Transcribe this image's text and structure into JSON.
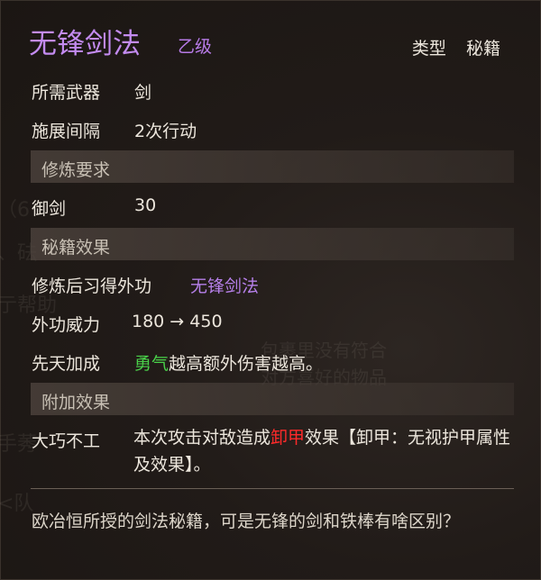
{
  "skill": {
    "name": "无锋剑法",
    "grade": "乙级",
    "type_label": "类型",
    "type_value": "秘籍"
  },
  "stats": {
    "weapon_label": "所需武器",
    "weapon_value": "剑",
    "interval_label": "施展间隔",
    "interval_value": "2次行动"
  },
  "requirements": {
    "header": "修炼要求",
    "skill_label": "御剑",
    "skill_value": "30"
  },
  "effects": {
    "header": "秘籍效果",
    "learn_label": "修炼后习得外功",
    "learn_value": "无锋剑法",
    "power_label": "外功威力",
    "power_value": "180 → 450",
    "innate_label": "先天加成",
    "innate_attr": "勇气",
    "innate_text": "越高额外伤害越高。"
  },
  "bonus": {
    "header": "附加效果",
    "name": "大巧不工",
    "desc_pre": "本次攻击对敌造成",
    "desc_red": "卸甲",
    "desc_post": "效果【卸甲：无视护甲属性及效果】。"
  },
  "flavor": "欧冶恒所授的剑法秘籍，可是无锋的剑和铁棒有啥区别？",
  "colors": {
    "title": "#c38bf0",
    "accent_purple": "#b57fe8",
    "attr_green": "#4ad24a",
    "debuff_red": "#ff2a2a"
  }
}
